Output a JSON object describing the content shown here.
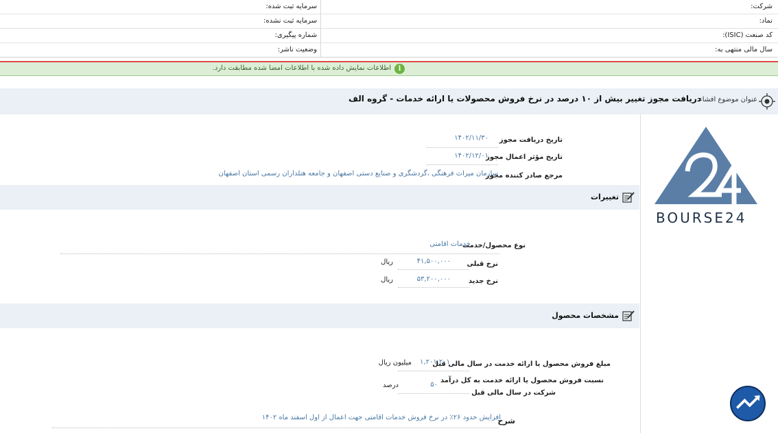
{
  "info": {
    "company_label": "شرکت:",
    "registered_capital_label": "سرمایه ثبت شده:",
    "symbol_label": "نماد:",
    "unregistered_capital_label": "سرمایه ثبت نشده:",
    "isic_label": "کد صنعت (ISIC):",
    "tracking_label": "شماره پیگیری:",
    "fiscal_year_label": "سال مالی منتهی به:",
    "publisher_status_label": "وضعیت ناشر:"
  },
  "alert": {
    "text": "اطلاعات نمایش داده شده با اطلاعات امضا شده مطابقت دارد.",
    "icon": "info-icon"
  },
  "title": {
    "label": "عنوان موضوع افشاء:",
    "value": "دریافت مجوز تغییر بیش از ۱۰ درصد در نرخ فروش محصولات یا ارائه خدمات - گروه الف"
  },
  "permit": {
    "receive_date_label": "تاریخ دریافت مجوز",
    "receive_date_value": "۱۴۰۲/۱۱/۳۰",
    "effective_date_label": "تاریخ مؤثر اعمال مجوز",
    "effective_date_value": "۱۴۰۲/۱۲/۰۱",
    "issuer_label": "مرجع صادر کننده مجوز",
    "issuer_value": "سازمان میراث فرهنگی ،گردشگری و صنایع دستی اصفهان و جامعه هتلداران رسمی استان اصفهان"
  },
  "changes": {
    "title": "تغییرات",
    "product_type_label": "نوع محصول/خدمت",
    "product_type_value": "خدمات اقامتی",
    "prev_rate_label": "نرخ قبلی",
    "prev_rate_value": "۴۱,۵۰۰,۰۰۰",
    "prev_rate_unit": "ریال",
    "new_rate_label": "نرخ جدید",
    "new_rate_value": "۵۳,۲۰۰,۰۰۰",
    "new_rate_unit": "ریال"
  },
  "product": {
    "title": "مشخصات محصول",
    "sales_label": "مبلغ فروش محصول یا ارائه خدمت در سال مالی قبل",
    "sales_value": "۱,۲۰۱,۲۰۱",
    "sales_unit": "میلیون ریال",
    "ratio_label_1": "نسبت فروش محصول یا ارائه خدمت به کل درآمد",
    "ratio_label_2": "شرکت در سال مالی قبل",
    "ratio_value": "۵۰",
    "ratio_unit": "درصد",
    "desc_label": "شرح",
    "desc_value": "افزایش حدود ۲۶٪ در نرخ فروش خدمات اقامتی جهت اعمال از اول اسفند ماه ۱۴۰۲"
  },
  "logo": {
    "text": "BOURSE24"
  },
  "colors": {
    "accent": "#4a78a5",
    "logo": "#5a7ea6",
    "alert_bg": "#dcefd6",
    "section_bg": "#eaf0f5"
  }
}
